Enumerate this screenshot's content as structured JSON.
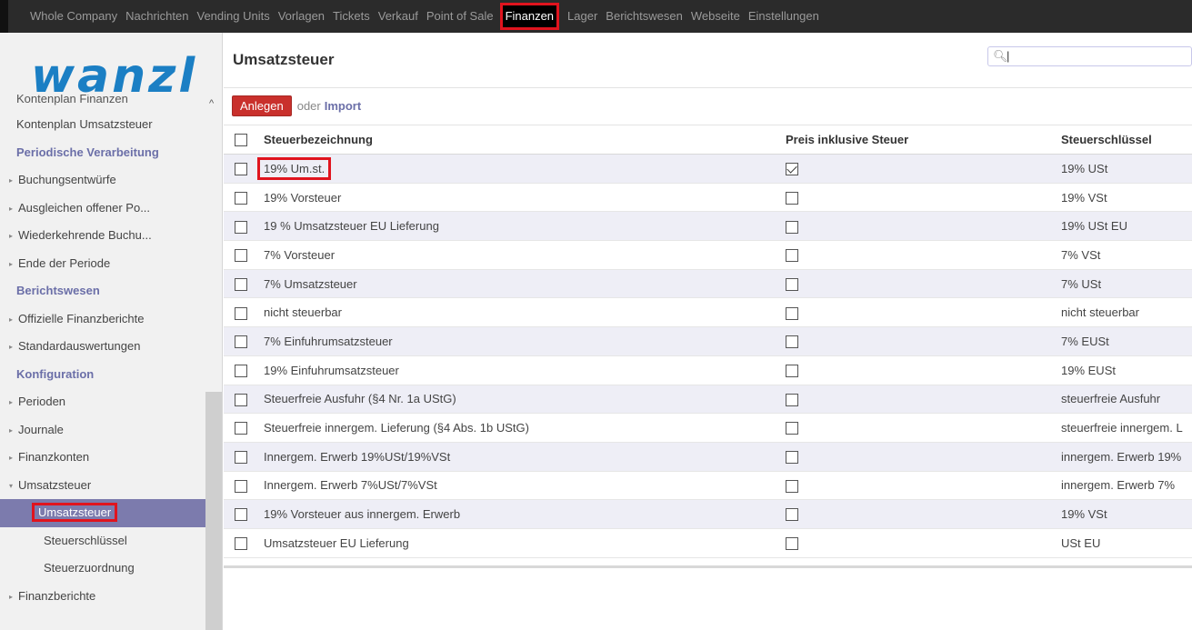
{
  "topnav": {
    "items": [
      {
        "label": "Whole Company",
        "active": false
      },
      {
        "label": "Nachrichten",
        "active": false
      },
      {
        "label": "Vending Units",
        "active": false
      },
      {
        "label": "Vorlagen",
        "active": false
      },
      {
        "label": "Tickets",
        "active": false
      },
      {
        "label": "Verkauf",
        "active": false
      },
      {
        "label": "Point of Sale",
        "active": false
      },
      {
        "label": "Finanzen",
        "active": true
      },
      {
        "label": "Lager",
        "active": false
      },
      {
        "label": "Berichtswesen",
        "active": false
      },
      {
        "label": "Webseite",
        "active": false
      },
      {
        "label": "Einstellungen",
        "active": false
      }
    ]
  },
  "logo": {
    "text": "wanzl",
    "color": "#1b7fc4"
  },
  "sidebar": {
    "items": [
      {
        "label": "Kontenplan Finanzen",
        "kind": "cut"
      },
      {
        "label": "Kontenplan Umsatzsteuer",
        "kind": "item"
      },
      {
        "label": "Periodische Verarbeitung",
        "kind": "head"
      },
      {
        "label": "Buchungsentwürfe",
        "kind": "sub"
      },
      {
        "label": "Ausgleichen offener Po...",
        "kind": "sub"
      },
      {
        "label": "Wiederkehrende Buchu...",
        "kind": "sub"
      },
      {
        "label": "Ende der Periode",
        "kind": "sub"
      },
      {
        "label": "Berichtswesen",
        "kind": "head"
      },
      {
        "label": "Offizielle Finanzberichte",
        "kind": "sub"
      },
      {
        "label": "Standardauswertungen",
        "kind": "sub"
      },
      {
        "label": "Konfiguration",
        "kind": "head"
      },
      {
        "label": "Perioden",
        "kind": "sub"
      },
      {
        "label": "Journale",
        "kind": "sub"
      },
      {
        "label": "Finanzkonten",
        "kind": "sub"
      },
      {
        "label": "Umsatzsteuer",
        "kind": "open"
      },
      {
        "label": "Umsatzsteuer",
        "kind": "selected"
      },
      {
        "label": "Steuerschlüssel",
        "kind": "subsub"
      },
      {
        "label": "Steuerzuordnung",
        "kind": "subsub"
      },
      {
        "label": "Finanzberichte",
        "kind": "sub"
      }
    ]
  },
  "main": {
    "title": "Umsatzsteuer",
    "search_value": "",
    "create_label": "Anlegen",
    "or_label": "oder",
    "import_label": "Import"
  },
  "table": {
    "columns": [
      "Steuerbezeichnung",
      "Preis inklusive Steuer",
      "Steuerschlüssel"
    ],
    "rows": [
      {
        "name": "19% Um.st.",
        "incl": true,
        "key": "19% USt"
      },
      {
        "name": "19% Vorsteuer",
        "incl": false,
        "key": "19% VSt"
      },
      {
        "name": "19 % Umsatzsteuer EU Lieferung",
        "incl": false,
        "key": "19% USt EU"
      },
      {
        "name": "7% Vorsteuer",
        "incl": false,
        "key": "7% VSt"
      },
      {
        "name": "7% Umsatzsteuer",
        "incl": false,
        "key": "7% USt"
      },
      {
        "name": "nicht steuerbar",
        "incl": false,
        "key": "nicht steuerbar"
      },
      {
        "name": "7% Einfuhrumsatzsteuer",
        "incl": false,
        "key": "7% EUSt"
      },
      {
        "name": "19% Einfuhrumsatzsteuer",
        "incl": false,
        "key": "19% EUSt"
      },
      {
        "name": "Steuerfreie Ausfuhr (§4 Nr. 1a UStG)",
        "incl": false,
        "key": "steuerfreie Ausfuhr"
      },
      {
        "name": "Steuerfreie innergem. Lieferung (§4 Abs. 1b UStG)",
        "incl": false,
        "key": "steuerfreie innergem. L"
      },
      {
        "name": "Innergem. Erwerb 19%USt/19%VSt",
        "incl": false,
        "key": "innergem. Erwerb 19%"
      },
      {
        "name": "Innergem. Erwerb 7%USt/7%VSt",
        "incl": false,
        "key": "innergem. Erwerb 7%"
      },
      {
        "name": "19% Vorsteuer aus innergem. Erwerb",
        "incl": false,
        "key": "19% VSt"
      },
      {
        "name": "Umsatzsteuer EU Lieferung",
        "incl": false,
        "key": "USt EU"
      }
    ]
  }
}
